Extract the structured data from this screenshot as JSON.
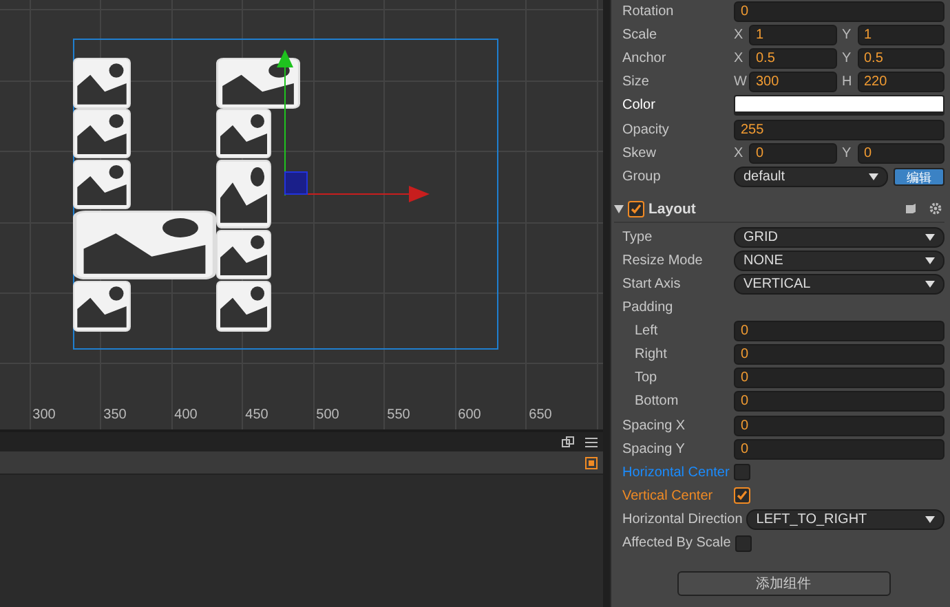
{
  "scene": {
    "ruler_labels": [
      "300",
      "350",
      "400",
      "450",
      "500",
      "550",
      "600",
      "650"
    ]
  },
  "node_properties": [
    {
      "kind": "single",
      "label": "Rotation",
      "value": "0"
    },
    {
      "kind": "pair",
      "label": "Scale",
      "a_label": "X",
      "a": "1",
      "b_label": "Y",
      "b": "1"
    },
    {
      "kind": "pair",
      "label": "Anchor",
      "a_label": "X",
      "a": "0.5",
      "b_label": "Y",
      "b": "0.5"
    },
    {
      "kind": "pair",
      "label": "Size",
      "a_label": "W",
      "a": "300",
      "b_label": "H",
      "b": "220"
    },
    {
      "kind": "color",
      "label": "Color",
      "color": "#ffffff"
    },
    {
      "kind": "single",
      "label": "Opacity",
      "value": "255"
    },
    {
      "kind": "pair",
      "label": "Skew",
      "a_label": "X",
      "a": "0",
      "b_label": "Y",
      "b": "0"
    },
    {
      "kind": "group",
      "label": "Group",
      "value": "default",
      "button": "编辑"
    }
  ],
  "layout_component": {
    "title": "Layout",
    "enabled": true,
    "expanded": true,
    "properties": [
      {
        "kind": "select",
        "label": "Type",
        "value": "GRID"
      },
      {
        "kind": "select",
        "label": "Resize Mode",
        "value": "NONE"
      },
      {
        "kind": "select",
        "label": "Start Axis",
        "value": "VERTICAL"
      },
      {
        "kind": "heading",
        "label": "Padding",
        "children": [
          {
            "kind": "single",
            "label": "Left",
            "value": "0"
          },
          {
            "kind": "single",
            "label": "Right",
            "value": "0"
          },
          {
            "kind": "single",
            "label": "Top",
            "value": "0"
          },
          {
            "kind": "single",
            "label": "Bottom",
            "value": "0"
          }
        ]
      },
      {
        "kind": "single",
        "label": "Spacing X",
        "value": "0"
      },
      {
        "kind": "single",
        "label": "Spacing Y",
        "value": "0"
      },
      {
        "kind": "check",
        "label": "Horizontal Center",
        "checked": false,
        "color": "#1a8cff"
      },
      {
        "kind": "check",
        "label": "Vertical Center",
        "checked": true,
        "color": "#f08a24"
      },
      {
        "kind": "select",
        "label": "Horizontal Direction",
        "value": "LEFT_TO_RIGHT"
      },
      {
        "kind": "check",
        "label": "Affected By Scale",
        "checked": false
      }
    ]
  },
  "add_component_button": "添加组件"
}
